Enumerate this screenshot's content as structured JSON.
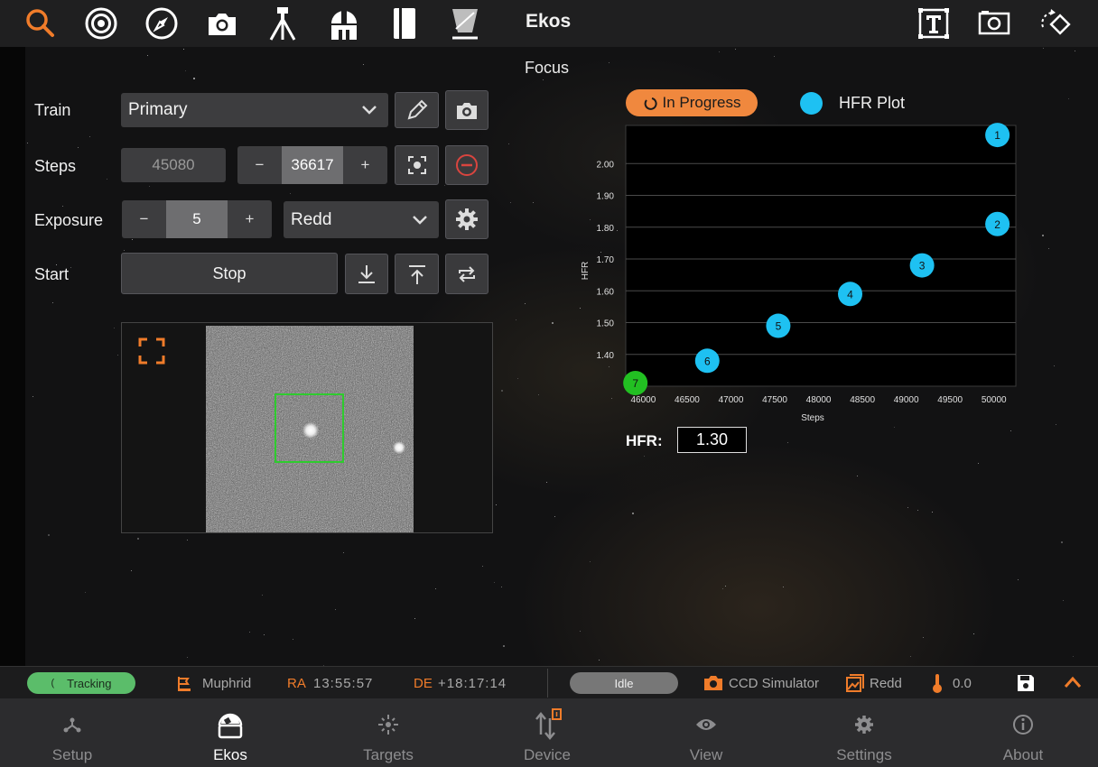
{
  "app": {
    "title": "Ekos",
    "section": "Focus"
  },
  "toolbar": {
    "icons": [
      "search-icon",
      "target-icon",
      "compass-icon",
      "camera-icon",
      "tripod-icon",
      "observatory-icon",
      "notebook-icon",
      "flat-panel-icon",
      "fit-text-icon",
      "preview-frame-icon",
      "rotate-icon"
    ]
  },
  "form": {
    "train_label": "Train",
    "train_value": "Primary",
    "steps_label": "Steps",
    "steps_current": "45080",
    "steps_target": "36617",
    "exposure_label": "Exposure",
    "exposure_value": "5",
    "filter_value": "Redd",
    "start_label": "Start",
    "stop_button": "Stop",
    "minus": "−",
    "plus": "+"
  },
  "status": {
    "state": "In Progress"
  },
  "chart_data": {
    "type": "scatter",
    "title": "",
    "legend": [
      "HFR Plot"
    ],
    "xlabel": "Steps",
    "ylabel": "HFR",
    "xlim": [
      45800,
      50250
    ],
    "ylim": [
      1.3,
      2.12
    ],
    "xticks": [
      46000,
      46500,
      47000,
      47500,
      48000,
      48500,
      49000,
      49500,
      50000
    ],
    "yticks": [
      1.4,
      1.5,
      1.6,
      1.7,
      1.8,
      1.9,
      2.0
    ],
    "grid": true,
    "series": [
      {
        "name": "HFR Plot",
        "color": "#1ec1f2",
        "points": [
          {
            "label": "1",
            "x": 50040,
            "y": 2.09
          },
          {
            "label": "2",
            "x": 50040,
            "y": 1.81
          },
          {
            "label": "3",
            "x": 49180,
            "y": 1.68
          },
          {
            "label": "4",
            "x": 48360,
            "y": 1.59
          },
          {
            "label": "5",
            "x": 47540,
            "y": 1.49
          },
          {
            "label": "6",
            "x": 46730,
            "y": 1.38
          },
          {
            "label": "7",
            "x": 45910,
            "y": 1.31,
            "color": "#22c022"
          }
        ]
      }
    ]
  },
  "hfr": {
    "label": "HFR:",
    "value": "1.30"
  },
  "statusbar": {
    "tracking": "Tracking",
    "target_name": "Muphrid",
    "ra_label": "RA",
    "ra_value": "13:55:57",
    "de_label": "DE",
    "de_value": "+18:17:14",
    "capture_state": "Idle",
    "camera": "CCD Simulator",
    "filter": "Redd",
    "temperature": "0.0",
    "accent": "#f07c2a",
    "tracking_color": "#5bbd6a"
  },
  "nav": [
    {
      "label": "Setup"
    },
    {
      "label": "Ekos"
    },
    {
      "label": "Targets"
    },
    {
      "label": "Device"
    },
    {
      "label": "View"
    },
    {
      "label": "Settings"
    },
    {
      "label": "About"
    }
  ]
}
